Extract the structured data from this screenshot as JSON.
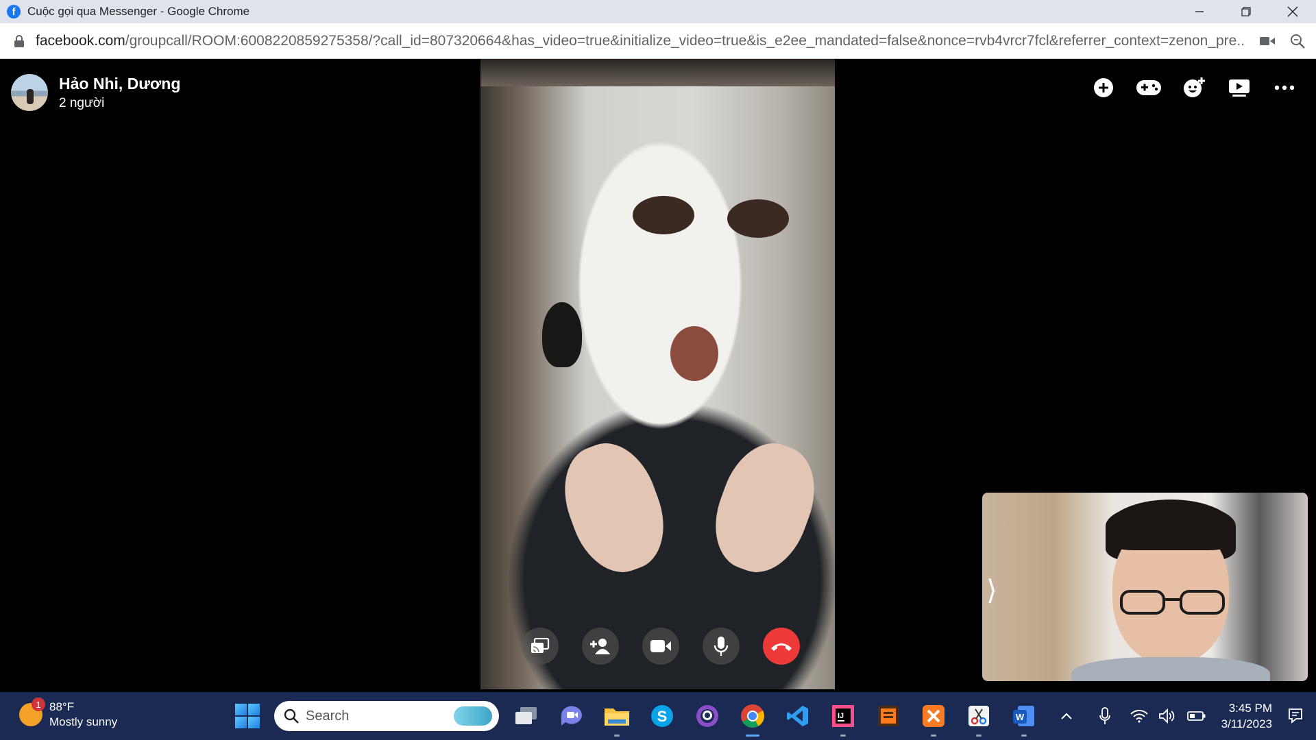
{
  "window": {
    "title": "Cuộc gọi qua Messenger - Google Chrome"
  },
  "address_bar": {
    "url_host": "facebook.com",
    "url_path": "/groupcall/ROOM:6008220859275358/?call_id=807320664&has_video=true&initialize_video=true&is_e2ee_mandated=false&nonce=rvb4vrcr7fcl&referrer_context=zenon_pre..."
  },
  "call": {
    "group_name": "Hảo Nhi, Dương",
    "participants_count": "2 người",
    "top_actions": [
      "add-icon",
      "gamepad-icon",
      "effects-icon",
      "watch-together-icon",
      "more-icon"
    ],
    "controls": [
      "share-screen-icon",
      "add-person-icon",
      "camera-icon",
      "microphone-icon",
      "end-call-icon"
    ],
    "colors": {
      "end_call": "#ef3a3a",
      "facebook_blue": "#1877f2"
    }
  },
  "taskbar": {
    "weather": {
      "temperature": "88°F",
      "condition": "Mostly sunny",
      "badge": "1"
    },
    "search_placeholder": "Search",
    "apps": [
      "task-view",
      "teams",
      "file-explorer",
      "skype",
      "github-desktop",
      "chrome",
      "vscode",
      "intellij",
      "sublime",
      "xampp",
      "snipping-tool",
      "word"
    ],
    "clock": {
      "time": "3:45 PM",
      "date": "3/11/2023"
    }
  }
}
